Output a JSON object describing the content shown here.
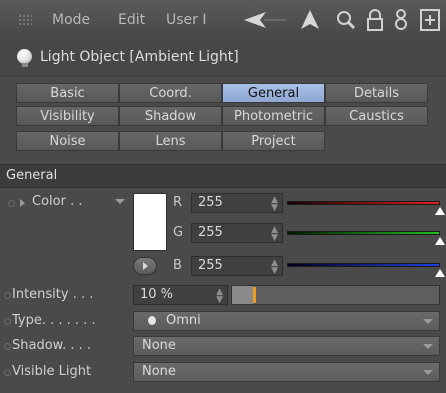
{
  "menu": {
    "items": [
      "Mode",
      "Edit",
      "User I"
    ],
    "icons": [
      "back-arrow-icon",
      "cursor-icon",
      "search-icon",
      "lock-icon",
      "settings-icon",
      "new-window-icon"
    ]
  },
  "object": {
    "title": "Light Object [Ambient Light]",
    "icon": "light-bulb-icon"
  },
  "tabs": {
    "row1": [
      "Basic",
      "Coord.",
      "General",
      "Details"
    ],
    "row2": [
      "Visibility",
      "Shadow",
      "Photometric",
      "Caustics"
    ],
    "row3": [
      "Noise",
      "Lens",
      "Project"
    ],
    "active": "General"
  },
  "section": {
    "title": "General"
  },
  "color": {
    "label": "Color . .",
    "swatch": "#ffffff",
    "r_label": "R",
    "r_value": "255",
    "g_label": "G",
    "g_value": "255",
    "b_label": "B",
    "b_value": "255",
    "r_slider": 1.0,
    "g_slider": 1.0,
    "b_slider": 1.0
  },
  "intensity": {
    "label": "Intensity . . .",
    "value": "10 %",
    "level": 0.1
  },
  "type": {
    "label": "Type. . . . . . .",
    "value": "Omni"
  },
  "shadow": {
    "label": "Shadow. . . .",
    "value": "None"
  },
  "visible_light": {
    "label": "Visible Light",
    "value": "None"
  },
  "colors": {
    "accent": "#8ea8d4",
    "intensity_marker": "#e8a020",
    "red": "#e02020",
    "green": "#20c020",
    "blue": "#2040e0"
  }
}
